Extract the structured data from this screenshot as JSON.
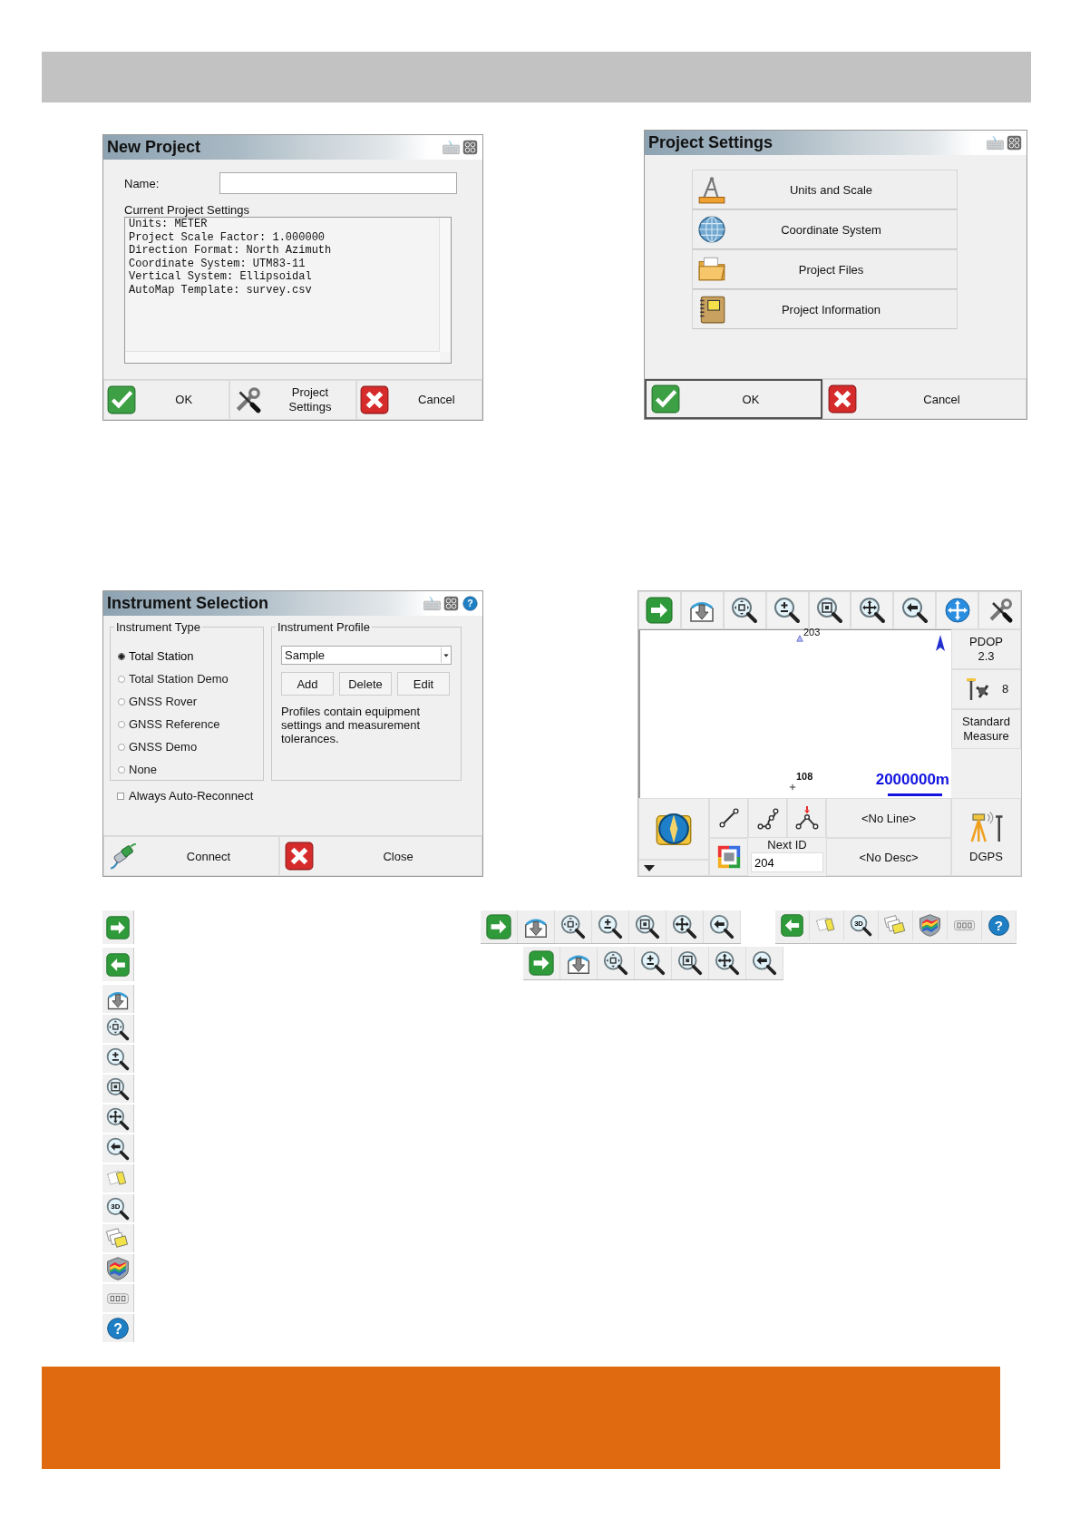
{
  "new_project": {
    "title": "New Project",
    "name_label": "Name:",
    "settings_label": "Current Project Settings",
    "settings_lines": [
      "Units: METER",
      "Project Scale Factor: 1.000000",
      "Direction Format: North Azimuth",
      "Coordinate System: UTM83-11",
      "Vertical System: Ellipsoidal",
      "AutoMap Template: survey.csv"
    ],
    "buttons": [
      {
        "kind": "ok",
        "label": "OK"
      },
      {
        "kind": "settings",
        "label": "Project Settings"
      },
      {
        "kind": "cancel",
        "label": "Cancel"
      }
    ]
  },
  "project_settings": {
    "title": "Project Settings",
    "items": [
      {
        "kind": "units",
        "label": "Units and Scale"
      },
      {
        "kind": "coordinates",
        "label": "Coordinate System"
      },
      {
        "kind": "files",
        "label": "Project Files"
      },
      {
        "kind": "information",
        "label": "Project Information"
      }
    ],
    "buttons": [
      {
        "kind": "ok",
        "label": "OK",
        "selected": true
      },
      {
        "kind": "cancel",
        "label": "Cancel",
        "selected": false
      }
    ]
  },
  "instrument_selection": {
    "title": "Instrument Selection",
    "help_text": "?",
    "type_legend": "Instrument Type",
    "types": [
      {
        "label": "Total Station",
        "selected": true
      },
      {
        "label": "Total Station Demo",
        "selected": false
      },
      {
        "label": "GNSS Rover",
        "selected": false
      },
      {
        "label": "GNSS Reference",
        "selected": false
      },
      {
        "label": "GNSS Demo",
        "selected": false
      },
      {
        "label": "None",
        "selected": false
      }
    ],
    "profile_legend": "Instrument Profile",
    "profile_value": "Sample",
    "profile_buttons": [
      "Add",
      "Delete",
      "Edit"
    ],
    "note": "Profiles contain equipment settings and measurement tolerances.",
    "auto_reconnect": {
      "label": "Always Auto-Reconnect",
      "checked": false
    },
    "buttons": [
      {
        "kind": "connect",
        "label": "Connect"
      },
      {
        "kind": "close",
        "label": "Close"
      }
    ]
  },
  "map_screen": {
    "points": [
      {
        "kind": "triangle",
        "label": "203"
      },
      {
        "kind": "cross",
        "label": "108"
      }
    ],
    "scale": "2000000m",
    "pdop_label": "PDOP",
    "pdop_value": "2.3",
    "satellites": "8",
    "mode": "Standard Measure",
    "line": "<No Line>",
    "next_id_label": "Next ID",
    "next_id": "204",
    "description": "<No Desc>",
    "status": "DGPS"
  },
  "toolbars": [
    {
      "items": [
        {
          "kind": "arrow-right"
        },
        {
          "kind": "tray"
        },
        {
          "kind": "zoom-extents"
        },
        {
          "kind": "zoom-pm"
        },
        {
          "kind": "zoom-window"
        },
        {
          "kind": "zoom-pan"
        },
        {
          "kind": "zoom-prev"
        }
      ]
    },
    {
      "items": [
        {
          "kind": "arrow-left"
        },
        {
          "kind": "select-sheet"
        },
        {
          "kind": "zoom-3d",
          "text": "3D"
        },
        {
          "kind": "sheets"
        },
        {
          "kind": "terrain"
        },
        {
          "kind": "dots"
        },
        {
          "kind": "help",
          "text": "?"
        }
      ]
    },
    {
      "items": [
        {
          "kind": "arrow-right"
        },
        {
          "kind": "tray"
        },
        {
          "kind": "zoom-extents"
        },
        {
          "kind": "zoom-pm"
        },
        {
          "kind": "zoom-window"
        },
        {
          "kind": "zoom-pan"
        },
        {
          "kind": "zoom-prev"
        }
      ]
    }
  ],
  "icon_legend": [
    {
      "kind": "arrow-right"
    },
    {
      "kind": "arrow-left"
    },
    {
      "kind": "tray"
    },
    {
      "kind": "zoom-extents"
    },
    {
      "kind": "zoom-pm"
    },
    {
      "kind": "zoom-window"
    },
    {
      "kind": "zoom-pan"
    },
    {
      "kind": "zoom-prev"
    },
    {
      "kind": "select-sheet"
    },
    {
      "kind": "zoom-3d",
      "text": "3D"
    },
    {
      "kind": "sheets"
    },
    {
      "kind": "terrain"
    },
    {
      "kind": "dots"
    },
    {
      "kind": "help",
      "text": "?"
    }
  ]
}
